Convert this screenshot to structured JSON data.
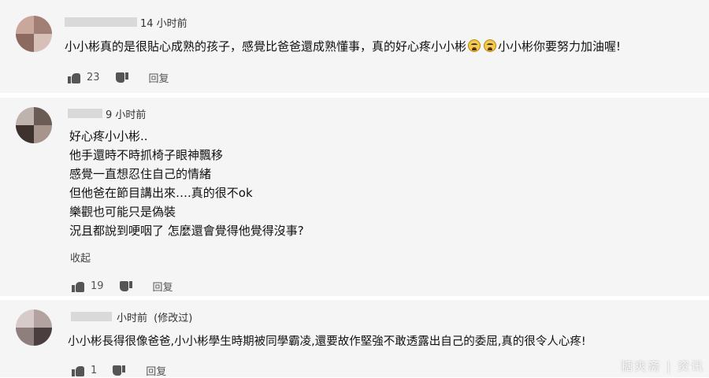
{
  "comments": [
    {
      "time": "14 小时前",
      "lines": [
        "小小彬真的是很貼心成熟的孩子，感覺比爸爸還成熟懂事，真的好心疼小小彬",
        "小小彬你要努力加油喔!"
      ],
      "emojis": [
        "crying-face",
        "crying-face"
      ],
      "likes": "23",
      "reply_label": "回复"
    },
    {
      "time": "9 小时前",
      "lines": [
        "好心疼小小彬..",
        "他手還時不時抓椅子眼神飄移",
        "感覺一直想忍住自己的情緒",
        "但他爸在節目講出來….真的很不ok",
        "樂觀也可能只是偽裝",
        "況且都說到哽咽了 怎麼還會覺得他覺得沒事?"
      ],
      "collapse_label": "收起",
      "likes": "19",
      "reply_label": "回复"
    },
    {
      "time": "小时前",
      "edited": "(修改过)",
      "lines": [
        "小小彬長得很像爸爸,小小彬學生時期被同學霸凌,還要故作堅強不敢透露出自己的委屈,真的很令人心疼!"
      ],
      "likes": "1",
      "reply_label": "回复"
    }
  ],
  "watermark": "糖爽斋 | 资讯",
  "colors": {
    "card_bg": "#f5f5f5",
    "text": "#111111",
    "meta": "#555555"
  }
}
